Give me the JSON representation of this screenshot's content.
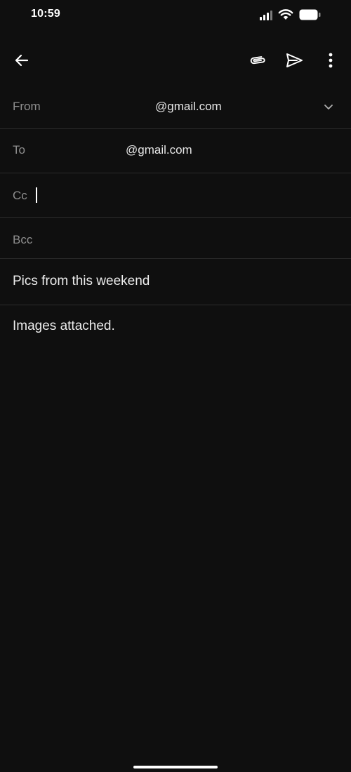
{
  "status_bar": {
    "time": "10:59",
    "signal_icon": "cellular-signal-icon",
    "wifi_icon": "wifi-icon",
    "battery_icon": "battery-icon"
  },
  "toolbar": {
    "back_icon": "arrow-left-icon",
    "attach_icon": "paperclip-icon",
    "send_icon": "send-icon",
    "more_icon": "more-vert-icon"
  },
  "compose": {
    "from_label": "From",
    "from_value": "@gmail.com",
    "from_dropdown_icon": "chevron-down-icon",
    "to_label": "To",
    "to_value": "@gmail.com",
    "cc_label": "Cc",
    "cc_value": "",
    "bcc_label": "Bcc",
    "bcc_value": "",
    "subject": "Pics from this weekend",
    "body": "Images attached."
  },
  "colors": {
    "background": "#0f0f0f",
    "divider": "#2c2c2c",
    "label": "#8f8f8f",
    "text": "#ededed"
  }
}
